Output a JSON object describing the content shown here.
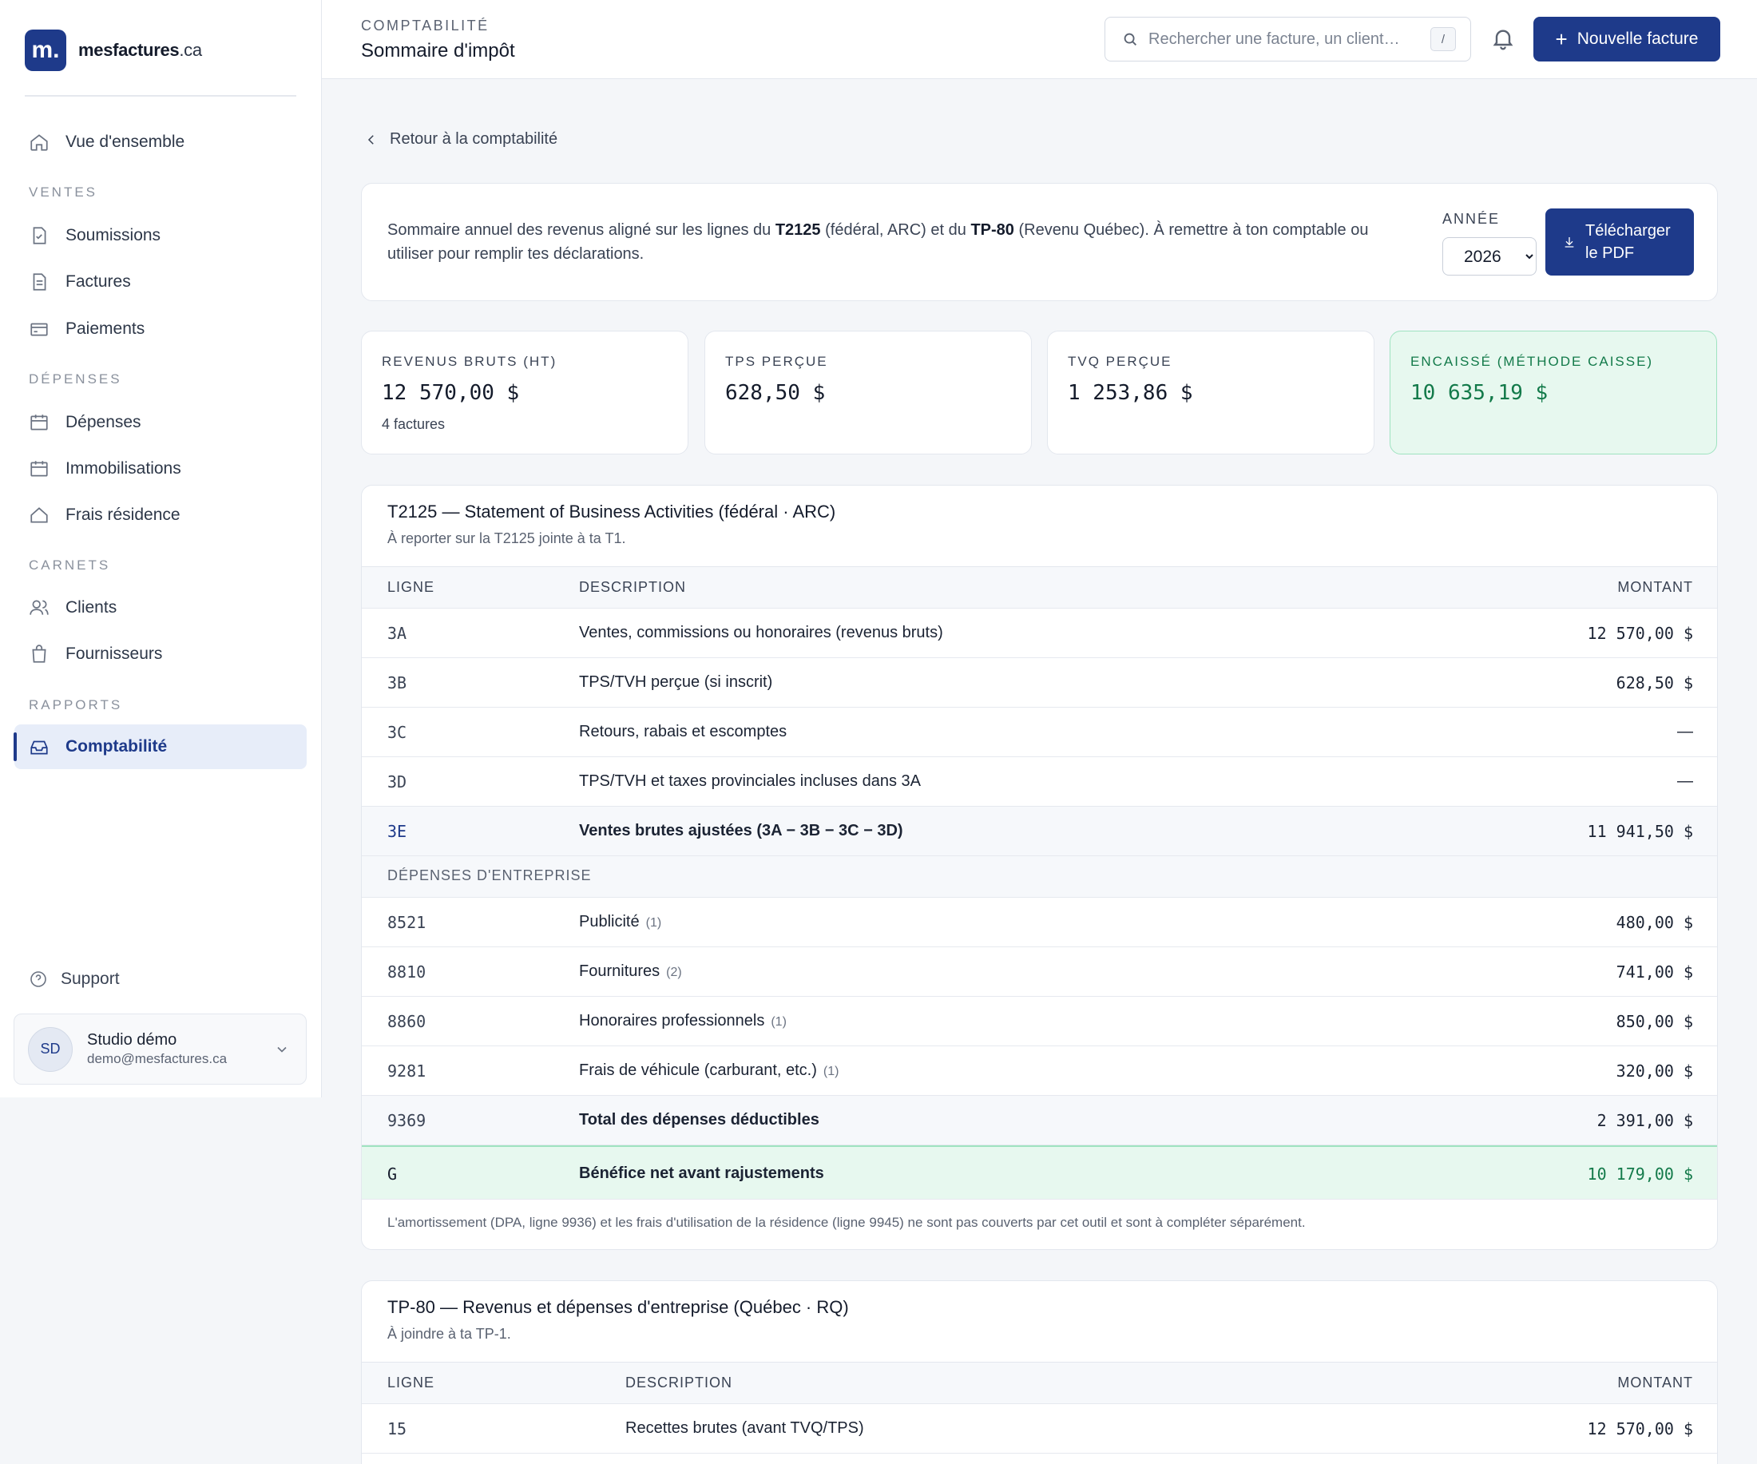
{
  "brand": {
    "logo": "m.",
    "name": "mesfactures",
    "tld": ".ca"
  },
  "nav": {
    "overview": "Vue d'ensemble",
    "section_sales": "VENTES",
    "quotes": "Soumissions",
    "invoices": "Factures",
    "payments": "Paiements",
    "section_expenses": "DÉPENSES",
    "expenses": "Dépenses",
    "assets": "Immobilisations",
    "home_costs": "Frais résidence",
    "section_books": "CARNETS",
    "clients": "Clients",
    "suppliers": "Fournisseurs",
    "section_reports": "RAPPORTS",
    "accounting": "Comptabilité",
    "active": "accounting"
  },
  "support": "Support",
  "user": {
    "initials": "SD",
    "name": "Studio démo",
    "email": "demo@mesfactures.ca"
  },
  "header": {
    "section": "COMPTABILITÉ",
    "title": "Sommaire d'impôt",
    "search_placeholder": "Rechercher une facture, un client…",
    "search_shortcut": "/",
    "new_invoice": "Nouvelle facture"
  },
  "back_link": "Retour à la comptabilité",
  "intro": {
    "text_1": "Sommaire annuel des revenus aligné sur les lignes du ",
    "t2125": "T2125",
    "text_2": " (fédéral, ARC) et du ",
    "tp80": "TP-80",
    "text_3": " (Revenu Québec). À remettre à ton comptable ou utiliser pour remplir tes déclarations.",
    "year_label": "ANNÉE",
    "year_value": "2026",
    "pdf_line1": "Télécharger",
    "pdf_line2": "le PDF"
  },
  "stats": {
    "gross": {
      "label": "REVENUS BRUTS (HT)",
      "value": "12 570,00 $",
      "sub": "4 factures"
    },
    "gst": {
      "label": "TPS PERÇUE",
      "value": "628,50 $"
    },
    "qst": {
      "label": "TVQ PERÇUE",
      "value": "1 253,86 $"
    },
    "cash": {
      "label": "ENCAISSÉ (MÉTHODE CAISSE)",
      "value": "10 635,19 $"
    }
  },
  "t2125": {
    "title": "T2125 — Statement of Business Activities (fédéral · ARC)",
    "subtitle": "À reporter sur la T2125 jointe à ta T1.",
    "col_line": "LIGNE",
    "col_desc": "DESCRIPTION",
    "col_amount": "MONTANT",
    "rows": [
      {
        "line": "3A",
        "desc": "Ventes, commissions ou honoraires (revenus bruts)",
        "amount": "12 570,00 $"
      },
      {
        "line": "3B",
        "desc": "TPS/TVH perçue (si inscrit)",
        "amount": "628,50 $"
      },
      {
        "line": "3C",
        "desc": "Retours, rabais et escomptes",
        "amount": "—"
      },
      {
        "line": "3D",
        "desc": "TPS/TVH et taxes provinciales incluses dans 3A",
        "amount": "—"
      },
      {
        "line": "3E",
        "desc": "Ventes brutes ajustées (3A − 3B − 3C − 3D)",
        "amount": "11 941,50 $"
      }
    ],
    "expenses_section": "DÉPENSES D'ENTREPRISE",
    "expense_rows": [
      {
        "line": "8521",
        "desc": "Publicité",
        "count": "(1)",
        "amount": "480,00 $"
      },
      {
        "line": "8810",
        "desc": "Fournitures",
        "count": "(2)",
        "amount": "741,00 $"
      },
      {
        "line": "8860",
        "desc": "Honoraires professionnels",
        "count": "(1)",
        "amount": "850,00 $"
      },
      {
        "line": "9281",
        "desc": "Frais de véhicule (carburant, etc.)",
        "count": "(1)",
        "amount": "320,00 $"
      }
    ],
    "total": {
      "line": "9369",
      "desc": "Total des dépenses déductibles",
      "amount": "2 391,00 $"
    },
    "net": {
      "line": "G",
      "desc": "Bénéfice net avant rajustements",
      "amount": "10 179,00 $"
    },
    "note": "L'amortissement (DPA, ligne 9936) et les frais d'utilisation de la résidence (ligne 9945) ne sont pas couverts par cet outil et sont à compléter séparément."
  },
  "tp80": {
    "title": "TP-80 — Revenus et dépenses d'entreprise (Québec · RQ)",
    "subtitle": "À joindre à ta TP-1.",
    "col_line": "LIGNE",
    "col_desc": "DESCRIPTION",
    "col_amount": "MONTANT",
    "rows": [
      {
        "line": "15",
        "desc": "Recettes brutes (avant TVQ/TPS)",
        "amount": "12 570,00 $"
      }
    ]
  },
  "colors": {
    "primary": "#1e3a8a",
    "success": "#137a4a",
    "success_bg": "#e7f8ef"
  }
}
